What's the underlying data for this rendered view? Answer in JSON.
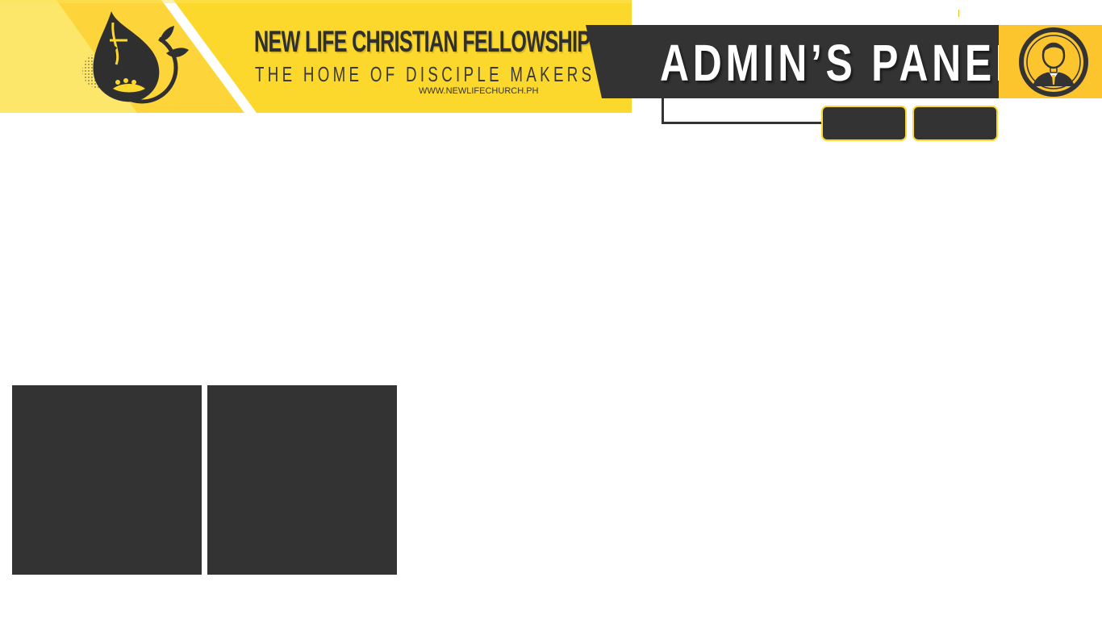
{
  "brand": {
    "title": "NEW LIFE CHRISTIAN FELLOWSHIP",
    "tagline": "THE HOME OF DISCIPLE MAKERS",
    "url": "WWW.NEWLIFECHURCH.PH",
    "logo_icon": "flame-leaf-logo-icon"
  },
  "admin": {
    "title": "ADMIN’S PANEL",
    "avatar_icon": "user-avatar-icon"
  },
  "nav_buttons": [
    {
      "label": ""
    },
    {
      "label": ""
    }
  ],
  "tiles": [
    {
      "label": ""
    },
    {
      "label": ""
    }
  ],
  "colors": {
    "brand_yellow": "#fcd82d",
    "avatar_yellow": "#fcc52d",
    "dark": "#333333",
    "white": "#ffffff"
  }
}
